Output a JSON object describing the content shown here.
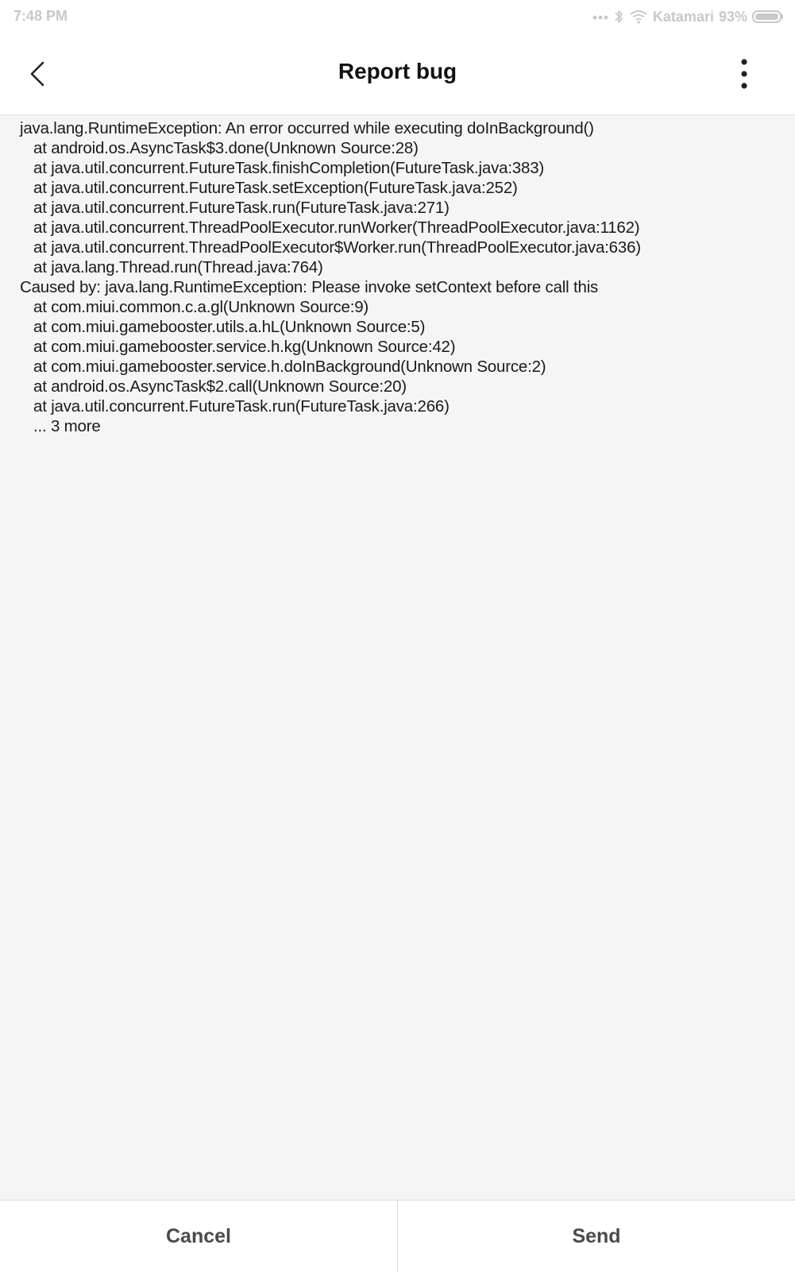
{
  "status_bar": {
    "time": "7:48 PM",
    "network": "Katamari",
    "battery": "93%"
  },
  "header": {
    "title": "Report bug"
  },
  "log": {
    "lines": [
      {
        "text": "java.lang.RuntimeException: An error occurred while executing doInBackground()",
        "indent": false
      },
      {
        "text": "at android.os.AsyncTask$3.done(Unknown Source:28)",
        "indent": true
      },
      {
        "text": "at java.util.concurrent.FutureTask.finishCompletion(FutureTask.java:383)",
        "indent": true
      },
      {
        "text": "at java.util.concurrent.FutureTask.setException(FutureTask.java:252)",
        "indent": true
      },
      {
        "text": "at java.util.concurrent.FutureTask.run(FutureTask.java:271)",
        "indent": true
      },
      {
        "text": "at java.util.concurrent.ThreadPoolExecutor.runWorker(ThreadPoolExecutor.java:1162)",
        "indent": true
      },
      {
        "text": "at java.util.concurrent.ThreadPoolExecutor$Worker.run(ThreadPoolExecutor.java:636)",
        "indent": true
      },
      {
        "text": "at java.lang.Thread.run(Thread.java:764)",
        "indent": true
      },
      {
        "text": "Caused by: java.lang.RuntimeException: Please invoke setContext before call this",
        "indent": false
      },
      {
        "text": "at com.miui.common.c.a.gl(Unknown Source:9)",
        "indent": true
      },
      {
        "text": "at com.miui.gamebooster.utils.a.hL(Unknown Source:5)",
        "indent": true
      },
      {
        "text": "at com.miui.gamebooster.service.h.kg(Unknown Source:42)",
        "indent": true
      },
      {
        "text": "at com.miui.gamebooster.service.h.doInBackground(Unknown Source:2)",
        "indent": true
      },
      {
        "text": "at android.os.AsyncTask$2.call(Unknown Source:20)",
        "indent": true
      },
      {
        "text": "at java.util.concurrent.FutureTask.run(FutureTask.java:266)",
        "indent": true
      },
      {
        "text": "... 3 more",
        "indent": true
      }
    ]
  },
  "footer": {
    "cancel_label": "Cancel",
    "send_label": "Send"
  },
  "colors": {
    "background": "#f5f5f5",
    "bar": "#ffffff",
    "status_text": "#c8c8c8",
    "button_text": "#4a4a4a"
  },
  "icons": {
    "back": "chevron-left-icon",
    "more": "more-vertical-icon",
    "bluetooth": "bluetooth-icon",
    "wifi": "wifi-icon",
    "battery": "battery-icon"
  }
}
